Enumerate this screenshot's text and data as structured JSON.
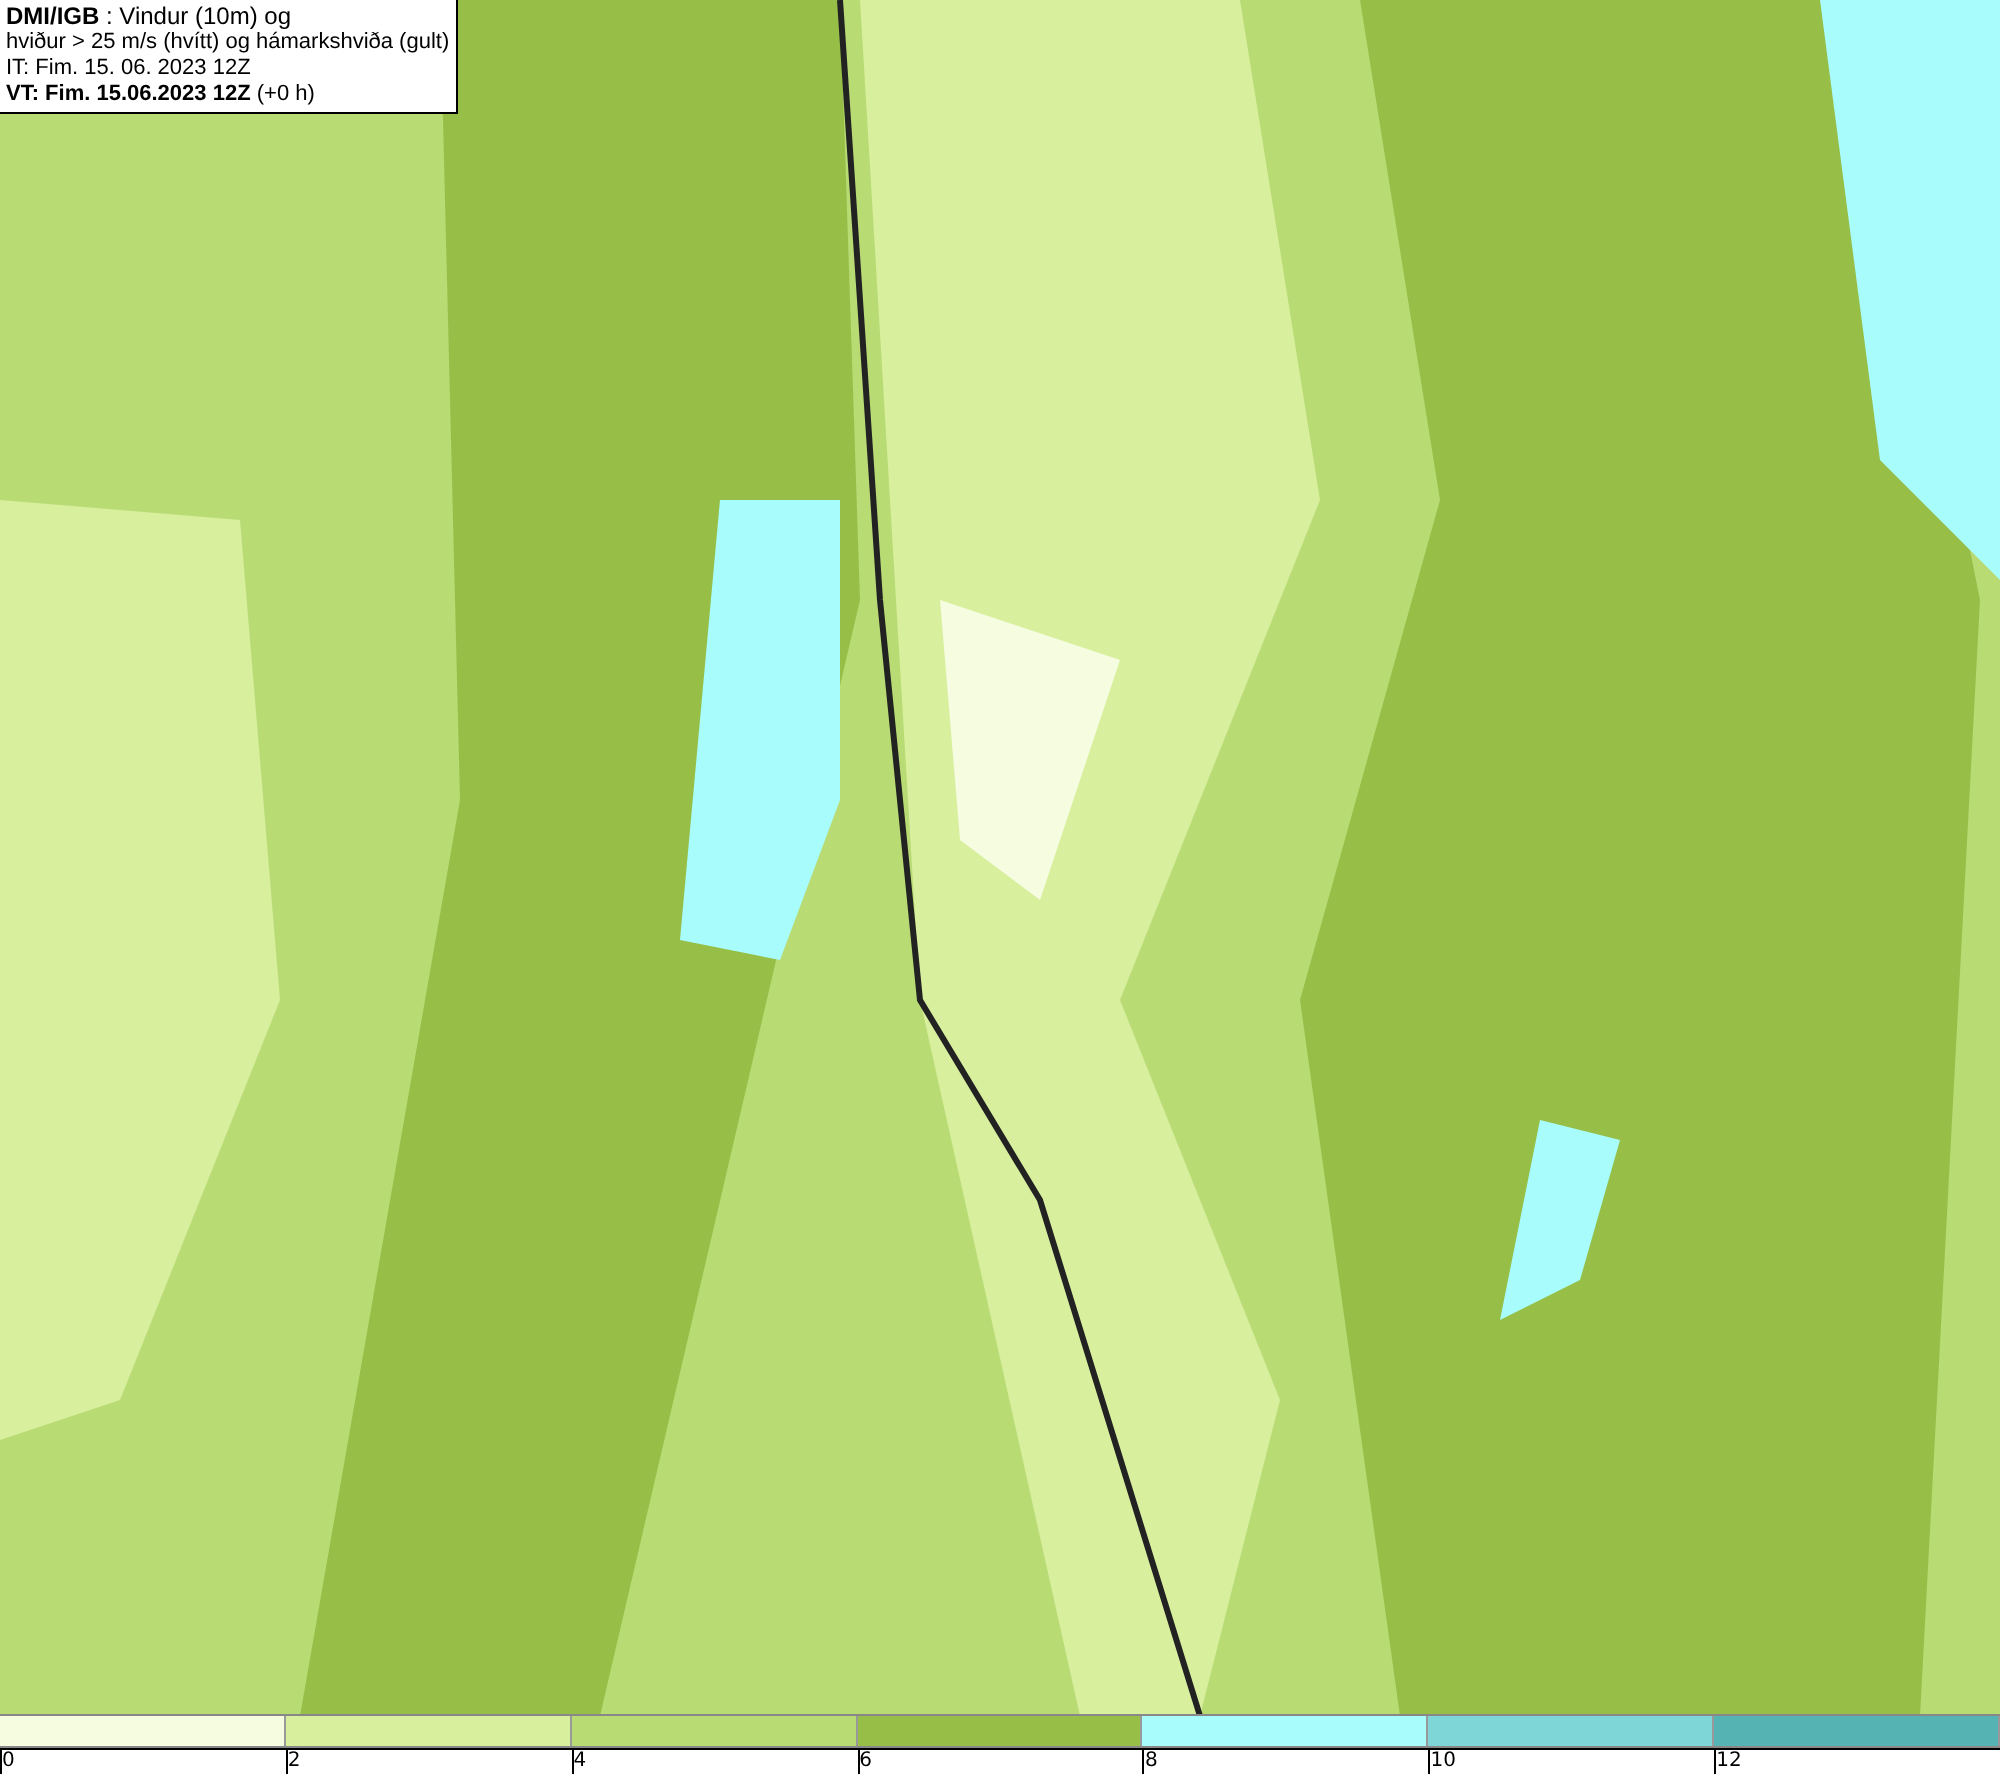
{
  "legend": {
    "lines": [
      "**DMI/IGB** : Vindur (10m) og",
      "hviður > 25 m/s (hvítt) og hámarkshviða (gult)",
      "IT: Fim. 15. 06. 2023 12Z",
      "**VT: Fim. 15.06.2023 12Z** (+0 h)"
    ]
  },
  "colorbar": {
    "swatches": [
      {
        "color": "#f5fce0"
      },
      {
        "color": "#d8ef9e"
      },
      {
        "color": "#b8db74"
      },
      {
        "color": "#97bf48"
      },
      {
        "color": "#a8fcfc"
      },
      {
        "color": "#7fd6d6"
      },
      {
        "color": "#56b3b3"
      }
    ],
    "ticks": [
      "0",
      "2",
      "4",
      "6",
      "8",
      "10",
      "12"
    ]
  }
}
